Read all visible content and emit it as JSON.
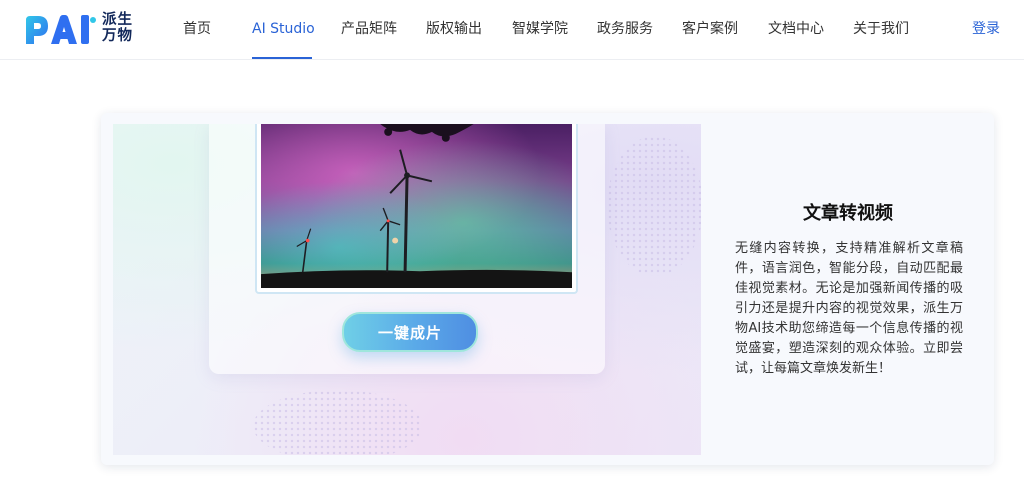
{
  "brand": {
    "logo_letters": "PAI",
    "name_line1": "派生",
    "name_line2": "万物",
    "colors": {
      "logo_primary": "#2f6ff0",
      "logo_accent": "#31c7e8"
    }
  },
  "nav": {
    "items": [
      {
        "label": "首页",
        "active": false
      },
      {
        "label": "AI Studio",
        "active": true
      },
      {
        "label": "产品矩阵",
        "active": false
      },
      {
        "label": "版权输出",
        "active": false
      },
      {
        "label": "智媒学院",
        "active": false
      },
      {
        "label": "政务服务",
        "active": false
      },
      {
        "label": "客户案例",
        "active": false
      },
      {
        "label": "文档中心",
        "active": false
      },
      {
        "label": "关于我们",
        "active": false
      }
    ],
    "login_label": "登录",
    "active_color": "#2a63d6"
  },
  "feature": {
    "image_subject": "aurora-over-wind-turbines",
    "button_label": "一键成片",
    "title": "文章转视频",
    "description": "无缝内容转换，支持精准解析文章稿件，语言润色，智能分段，自动匹配最佳视觉素材。无论是加强新闻传播的吸引力还是提升内容的视觉效果，派生万物AI技术助您缔造每一个信息传播的视觉盛宴，塑造深刻的观众体验。立即尝试，让每篇文章焕发新生！"
  }
}
